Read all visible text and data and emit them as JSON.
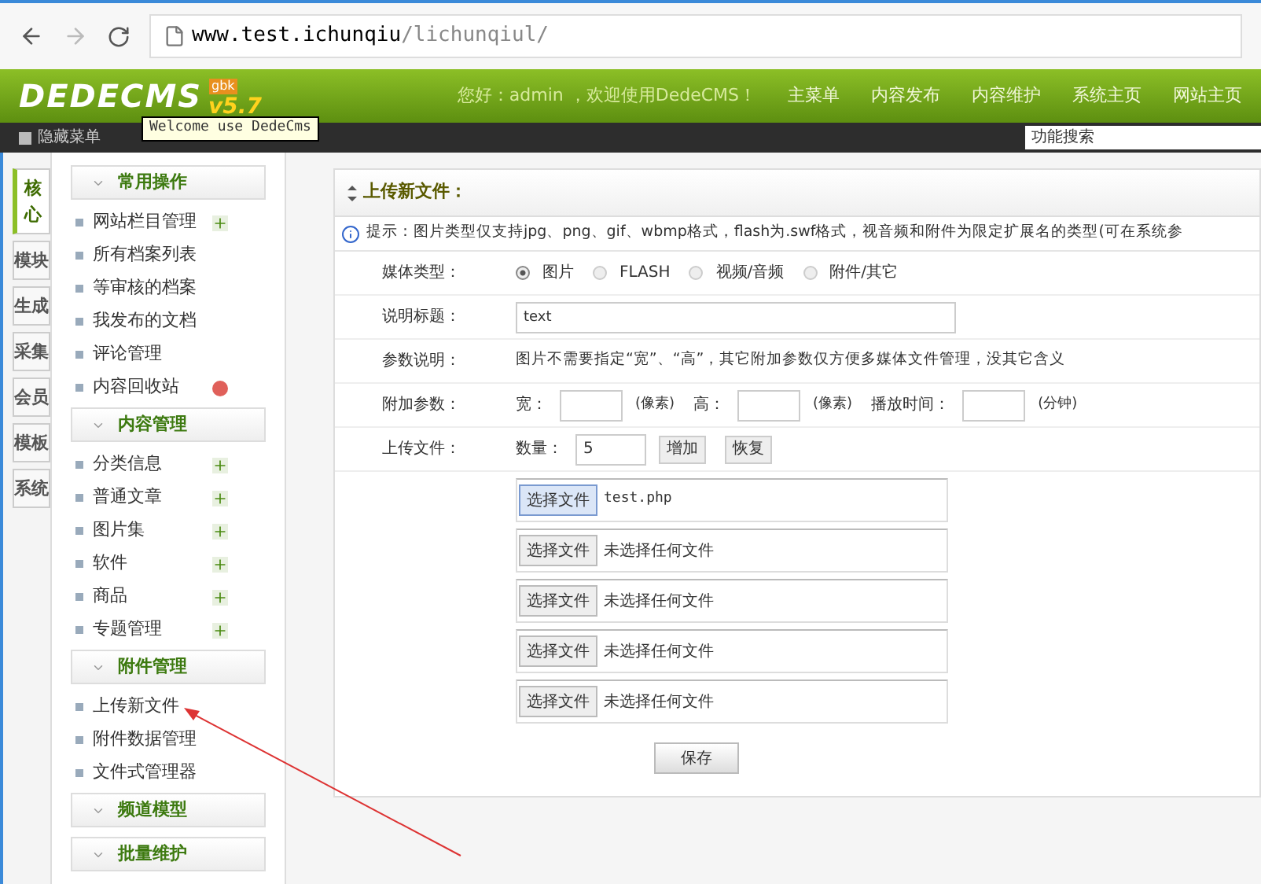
{
  "browser": {
    "url_host": "www.test.ichunqiu",
    "url_path": "/lichunqiul/"
  },
  "header": {
    "logo": "DEDECMS",
    "version": "v5.7",
    "edition": "gbk",
    "tooltip": "Welcome use DedeCms",
    "greeting": "您好：admin ，欢迎使用DedeCMS！",
    "nav": [
      {
        "label": "主菜单"
      },
      {
        "label": "内容发布"
      },
      {
        "label": "内容维护"
      },
      {
        "label": "系统主页"
      },
      {
        "label": "网站主页"
      }
    ]
  },
  "toolbar": {
    "hide_menu": "隐藏菜单",
    "search": {
      "placeholder": "功能搜索"
    }
  },
  "side_tabs": [
    {
      "label": "核心",
      "selected": true
    },
    {
      "label": "模块",
      "selected": false
    },
    {
      "label": "生成",
      "selected": false
    },
    {
      "label": "采集",
      "selected": false
    },
    {
      "label": "会员",
      "selected": false
    },
    {
      "label": "模板",
      "selected": false
    },
    {
      "label": "系统",
      "selected": false
    }
  ],
  "menu_groups": [
    {
      "title": "常用操作",
      "items": [
        {
          "label": "网站栏目管理",
          "kind": "add"
        },
        {
          "label": "所有档案列表",
          "kind": "plain"
        },
        {
          "label": "等审核的档案",
          "kind": "plain"
        },
        {
          "label": "我发布的文档",
          "kind": "plain"
        },
        {
          "label": "评论管理",
          "kind": "plain"
        },
        {
          "label": "内容回收站",
          "kind": "trash"
        }
      ]
    },
    {
      "title": "内容管理",
      "items": [
        {
          "label": "分类信息",
          "kind": "add"
        },
        {
          "label": "普通文章",
          "kind": "add"
        },
        {
          "label": "图片集",
          "kind": "add"
        },
        {
          "label": "软件",
          "kind": "add"
        },
        {
          "label": "商品",
          "kind": "add"
        },
        {
          "label": "专题管理",
          "kind": "add"
        }
      ]
    },
    {
      "title": "附件管理",
      "items": [
        {
          "label": "上传新文件",
          "kind": "plain"
        },
        {
          "label": "附件数据管理",
          "kind": "plain"
        },
        {
          "label": "文件式管理器",
          "kind": "plain"
        }
      ]
    },
    {
      "title": "频道模型"
    },
    {
      "title": "批量维护"
    }
  ],
  "panel": {
    "title": "上传新文件：",
    "tip": "提示：图片类型仅支持jpg、png、gif、wbmp格式，flash为.swf格式，视音频和附件为限定扩展名的类型(可在系统参",
    "media_label": "媒体类型：",
    "media_options": [
      {
        "label": "图片",
        "selected": true
      },
      {
        "label": "FLASH",
        "selected": false
      },
      {
        "label": "视频/音频",
        "selected": false
      },
      {
        "label": "附件/其它",
        "selected": false
      }
    ],
    "title_label": "说明标题：",
    "title_value": "text",
    "param_label": "参数说明：",
    "param_text": "图片不需要指定“宽”、“高”，其它附加参数仅方便多媒体文件管理，没其它含义",
    "extra_label": "附加参数：",
    "width_label": "宽：",
    "height_label": "高：",
    "pixel_unit": "(像素)",
    "pixel_unit_2": "(像素)",
    "duration_label": "播放时间：",
    "minute_unit": "(分钟)",
    "upload_label": "上传文件：",
    "count_label": "数量：",
    "count_value": "5",
    "add_button": "增加",
    "reset_button": "恢复",
    "files": [
      {
        "button": "选择文件",
        "file": "test.php",
        "selected": true
      },
      {
        "button": "选择文件",
        "file": "未选择任何文件",
        "selected": false
      },
      {
        "button": "选择文件",
        "file": "未选择任何文件",
        "selected": false
      },
      {
        "button": "选择文件",
        "file": "未选择任何文件",
        "selected": false
      },
      {
        "button": "选择文件",
        "file": "未选择任何文件",
        "selected": false
      }
    ],
    "save_button": "保存"
  }
}
